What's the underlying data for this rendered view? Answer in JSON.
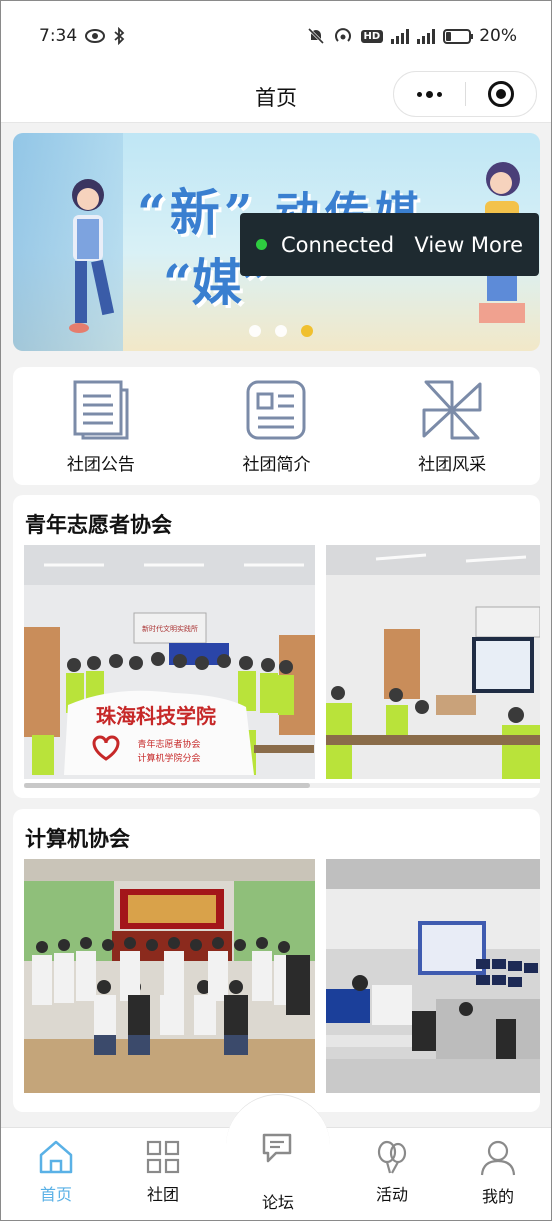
{
  "status_bar": {
    "time": "7:34",
    "battery": "20%",
    "battery_level": 0.2,
    "hd_label": "HD"
  },
  "nav": {
    "title": "首页"
  },
  "banner": {
    "title_part1": "“新”",
    "title_part2": "“媒”",
    "title_part3": "动传媒",
    "slide_count": 3,
    "active_slide": 3
  },
  "toast": {
    "status": "Connected",
    "action": "View More"
  },
  "quick_menu": [
    {
      "label": "社团公告",
      "icon": "document-icon"
    },
    {
      "label": "社团简介",
      "icon": "profile-card-icon"
    },
    {
      "label": "社团风采",
      "icon": "pinwheel-icon"
    }
  ],
  "sections": [
    {
      "title": "青年志愿者协会",
      "banner_text": "珠海科技学院",
      "banner_sub1": "青年志愿者协会",
      "banner_sub2": "计算机学院分会",
      "room_sign": "新时代文明实践所"
    },
    {
      "title": "计算机协会"
    }
  ],
  "tab_bar": [
    {
      "label": "首页",
      "icon": "home-icon",
      "active": true
    },
    {
      "label": "社团",
      "icon": "grid-icon",
      "active": false
    },
    {
      "label": "论坛",
      "icon": "chat-icon",
      "active": false
    },
    {
      "label": "活动",
      "icon": "balloon-icon",
      "active": false
    },
    {
      "label": "我的",
      "icon": "user-icon",
      "active": false
    }
  ],
  "colors": {
    "accent": "#5ab1e6",
    "icon_gray": "#7b8ba8",
    "toast_bg": "#1e2a30",
    "connected_green": "#2ecc40",
    "banner_dot_active": "#f0c02f"
  }
}
